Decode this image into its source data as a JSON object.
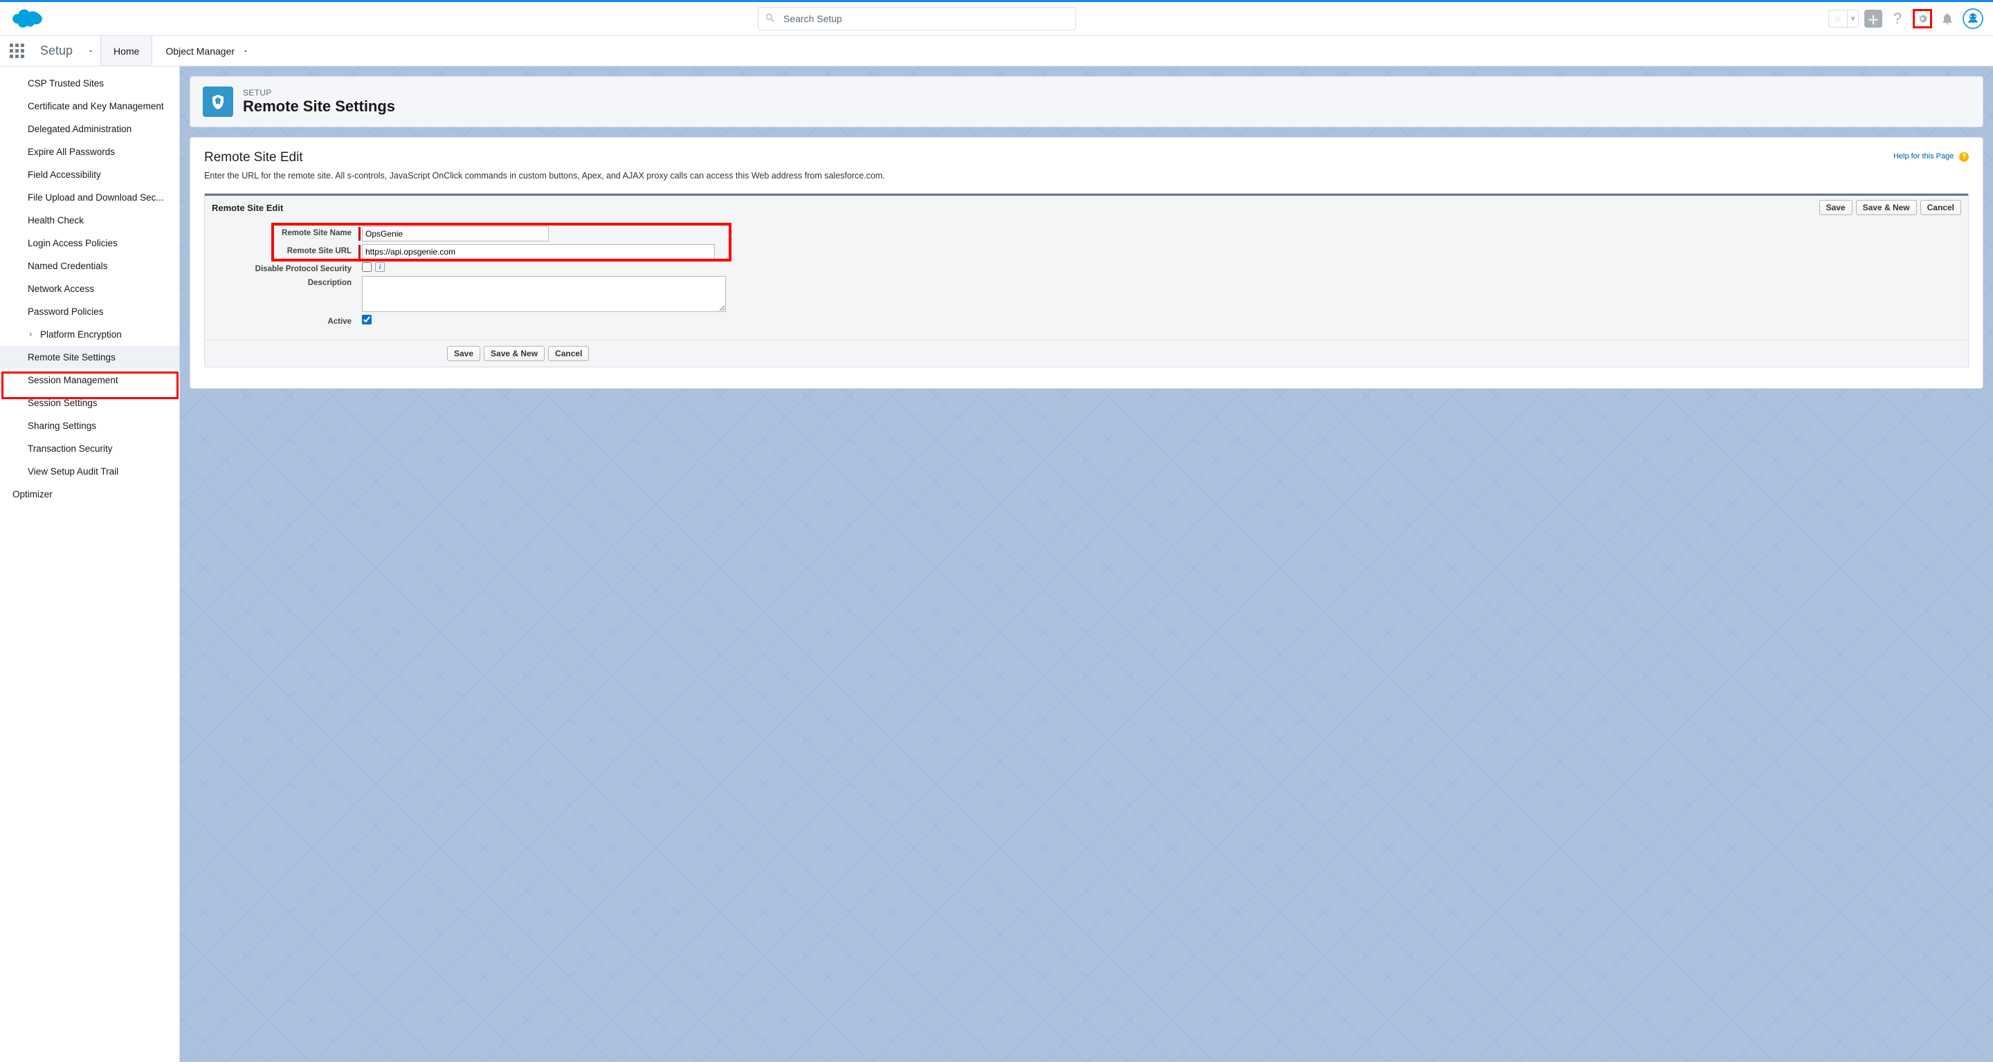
{
  "header": {
    "search_placeholder": "Search Setup"
  },
  "nav": {
    "setup_label": "Setup",
    "tabs": [
      "Home",
      "Object Manager"
    ]
  },
  "sidebar": {
    "items": [
      "CSP Trusted Sites",
      "Certificate and Key Management",
      "Delegated Administration",
      "Expire All Passwords",
      "Field Accessibility",
      "File Upload and Download Sec...",
      "Health Check",
      "Login Access Policies",
      "Named Credentials",
      "Network Access",
      "Password Policies",
      "Platform Encryption",
      "Remote Site Settings",
      "Session Management",
      "Session Settings",
      "Sharing Settings",
      "Transaction Security",
      "View Setup Audit Trail"
    ],
    "bottom": "Optimizer"
  },
  "page_header": {
    "eyebrow": "SETUP",
    "title": "Remote Site Settings"
  },
  "panel": {
    "heading": "Remote Site Edit",
    "help_link": "Help for this Page",
    "description": "Enter the URL for the remote site. All s-controls, JavaScript OnClick commands in custom buttons, Apex, and AJAX proxy calls can access this Web address from salesforce.com.",
    "block_title": "Remote Site Edit",
    "buttons": {
      "save": "Save",
      "save_new": "Save & New",
      "cancel": "Cancel"
    },
    "fields": {
      "name_label": "Remote Site Name",
      "name_value": "OpsGenie",
      "url_label": "Remote Site URL",
      "url_value": "https://api.opsgenie.com",
      "disable_label": "Disable Protocol Security",
      "disable_checked": false,
      "description_label": "Description",
      "description_value": "",
      "active_label": "Active",
      "active_checked": true
    }
  }
}
